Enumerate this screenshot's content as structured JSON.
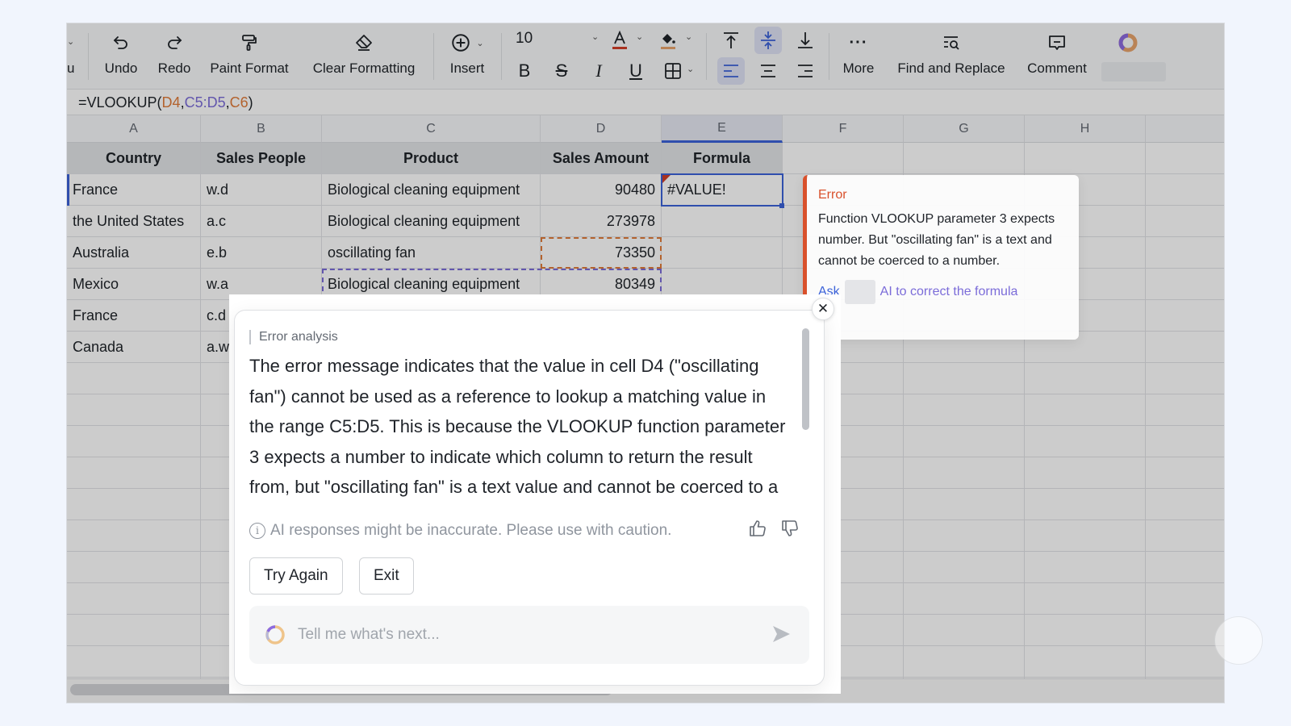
{
  "toolbar": {
    "truncated_label": "u",
    "undo": "Undo",
    "redo": "Redo",
    "paint_format": "Paint Format",
    "clear_formatting": "Clear Formatting",
    "insert": "Insert",
    "font_size": "10",
    "bold": "B",
    "italic": "I",
    "underline": "U",
    "strikethrough": "S",
    "more": "More",
    "find_replace": "Find and Replace",
    "comment": "Comment",
    "font_color": "#d33e27",
    "fill_color": "#e8a46c"
  },
  "formula_bar": {
    "prefix": "=VLOOKUP(",
    "arg1": "D4",
    "sep1": ",",
    "arg2": "C5:D5",
    "sep2": ",",
    "arg3": "C6",
    "suffix": ")"
  },
  "columns": [
    "A",
    "B",
    "C",
    "D",
    "E",
    "F",
    "G",
    "H"
  ],
  "selected_column": "E",
  "table": {
    "headers": [
      "Country",
      "Sales People",
      "Product",
      "Sales Amount",
      "Formula"
    ],
    "rows": [
      [
        "France",
        "w.d",
        "Biological cleaning equipment",
        "90480",
        "#VALUE!"
      ],
      [
        "the United States",
        "a.c",
        "Biological cleaning equipment",
        "273978",
        ""
      ],
      [
        "Australia",
        "e.b",
        "oscillating fan",
        "73350",
        ""
      ],
      [
        "Mexico",
        "w.a",
        "Biological cleaning equipment",
        "80349",
        ""
      ],
      [
        "France",
        "c.d",
        "",
        "",
        ""
      ],
      [
        "Canada",
        "a.w",
        "",
        "",
        ""
      ]
    ]
  },
  "error_tooltip": {
    "title": "Error",
    "message": "Function VLOOKUP parameter 3 expects number. But \"oscillating fan\" is a text and cannot be coerced to a number.",
    "ask": "Ask",
    "link": "AI to correct the formula"
  },
  "ai_panel": {
    "section_label": "Error analysis",
    "body": "The error message indicates that the value in cell D4 (\"oscillating fan\") cannot be used as a reference to lookup a matching value in the range C5:D5. This is because the VLOOKUP function parameter 3 expects a number to indicate which column to return the result from, but \"oscillating fan\" is a text value and cannot be coerced to a number.",
    "disclaimer": "AI responses might be inaccurate. Please use with caution.",
    "try_again": "Try Again",
    "exit": "Exit",
    "input_placeholder": "Tell me what's next...",
    "input_value": ""
  }
}
